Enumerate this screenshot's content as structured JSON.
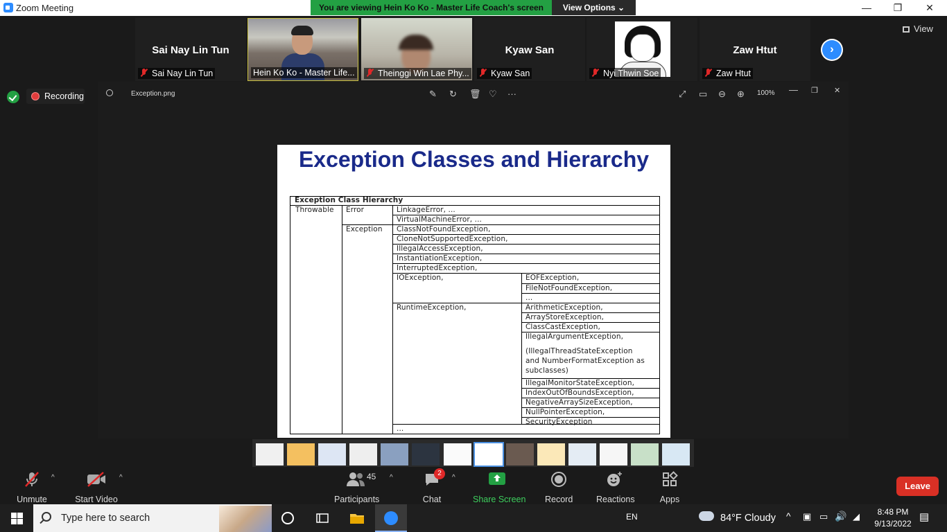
{
  "window": {
    "title": "Zoom Meeting",
    "minimize": "—",
    "restore": "❐",
    "close": "✕"
  },
  "banner": {
    "viewing": "You are viewing Hein Ko Ko - Master Life Coach's screen",
    "view_options": "View Options ⌄"
  },
  "participants_strip": [
    {
      "name_big": "Sai Nay Lin Tun",
      "label": "Sai Nay Lin Tun",
      "muted": true
    },
    {
      "name_big": "",
      "label": "Hein Ko Ko - Master Life...",
      "muted": false
    },
    {
      "name_big": "",
      "label": "Theinggi Win Lae Phy...",
      "muted": true
    },
    {
      "name_big": "Kyaw San",
      "label": "Kyaw San",
      "muted": true
    },
    {
      "name_big": "",
      "label": "Nyi Thwin Soe",
      "muted": true
    },
    {
      "name_big": "Zaw Htut",
      "label": "Zaw Htut",
      "muted": true
    }
  ],
  "next_arrow": "›",
  "view_button": "View",
  "recording_label": "Recording",
  "viewer": {
    "filename": "Exception.png",
    "zoom": "100%"
  },
  "slide": {
    "title": "Exception Classes and Hierarchy",
    "table_title": "Exception Class Hierarchy",
    "col1": "Throwable",
    "error": "Error",
    "exception": "Exception",
    "error_items": [
      "LinkageError, ...",
      "VirtualMachineError, ..."
    ],
    "exception_items": [
      "ClassNotFoundException,",
      "CloneNotSupportedException,",
      "IllegalAccessException,",
      "InstantiationException,",
      "InterruptedException,"
    ],
    "io": "IOException,",
    "io_items": [
      "EOFException,",
      "FileNotFoundException,",
      "..."
    ],
    "runtime": "RuntimeException,",
    "runtime_items": [
      "ArithmeticException,",
      "ArrayStoreException,",
      "ClassCastException,",
      "IllegalArgumentException,"
    ],
    "runtime_note": [
      "(IllegalThreadStateException",
      "and NumberFormatException as",
      "subclasses)"
    ],
    "runtime_items2": [
      "IllegalMonitorStateException,",
      "IndexOutOfBoundsException,",
      "NegativeArraySizeException,",
      "NullPointerException,",
      "SecurityException"
    ],
    "tail": "..."
  },
  "controls": {
    "unmute": "Unmute",
    "start_video": "Start Video",
    "participants": "Participants",
    "participants_count": "45",
    "chat": "Chat",
    "chat_badge": "2",
    "share_screen": "Share Screen",
    "record": "Record",
    "reactions": "Reactions",
    "apps": "Apps",
    "leave": "Leave"
  },
  "taskbar": {
    "search_placeholder": "Type here to search",
    "lang": "EN",
    "weather": "84°F  Cloudy",
    "time": "8:48 PM",
    "date": "9/13/2022"
  },
  "colors": {
    "zoom_blue": "#2d8cff",
    "banner_green": "#23a043",
    "leave_red": "#d93025",
    "slide_title": "#1a2a8a"
  }
}
